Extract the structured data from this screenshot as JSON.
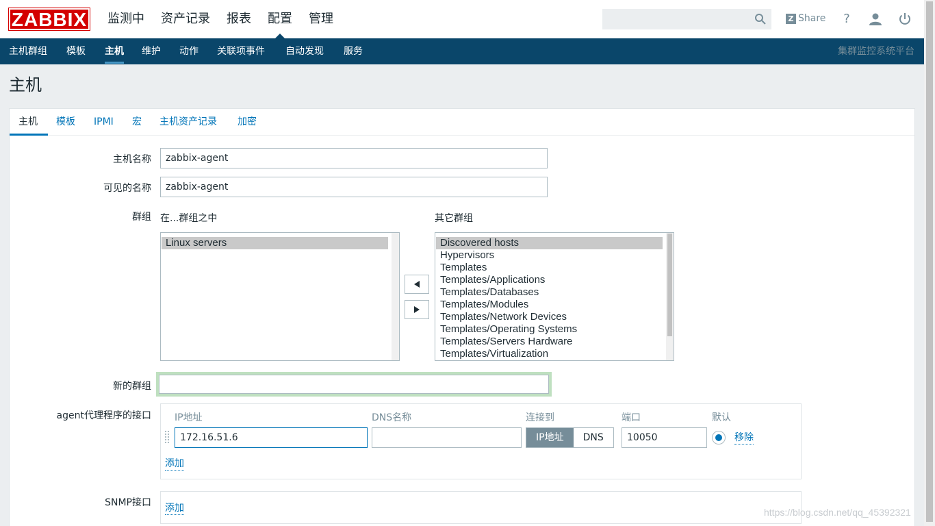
{
  "header": {
    "logo": "ZABBIX",
    "menu": [
      "监测中",
      "资产记录",
      "报表",
      "配置",
      "管理"
    ],
    "search_placeholder": "",
    "share_label": "Share",
    "icons": [
      "search-icon",
      "help-icon",
      "user-icon",
      "power-icon"
    ]
  },
  "subnav": {
    "items": [
      "主机群组",
      "模板",
      "主机",
      "维护",
      "动作",
      "关联项事件",
      "自动发现",
      "服务"
    ],
    "brand": "集群监控系统平台"
  },
  "page": {
    "title": "主机"
  },
  "tabs": [
    "主机",
    "模板",
    "IPMI",
    "宏",
    "主机资产记录",
    "加密"
  ],
  "form": {
    "host_name_label": "主机名称",
    "host_name_value": "zabbix-agent",
    "visible_name_label": "可见的名称",
    "visible_name_value": "zabbix-agent",
    "groups_label": "群组",
    "in_groups_label": "在...群组之中",
    "other_groups_label": "其它群组",
    "in_groups": [
      "Linux servers"
    ],
    "other_groups": [
      "Discovered hosts",
      "Hypervisors",
      "Templates",
      "Templates/Applications",
      "Templates/Databases",
      "Templates/Modules",
      "Templates/Network Devices",
      "Templates/Operating Systems",
      "Templates/Servers Hardware",
      "Templates/Virtualization"
    ],
    "new_group_label": "新的群组",
    "new_group_value": "",
    "agent_interfaces_label": "agent代理程序的接口",
    "col_ip": "IP地址",
    "col_dns": "DNS名称",
    "col_connect": "连接到",
    "col_port": "端口",
    "col_default": "默认",
    "ip_value": "172.16.51.6",
    "dns_value": "",
    "connect_ip": "IP地址",
    "connect_dns": "DNS",
    "port_value": "10050",
    "remove_label": "移除",
    "add_label": "添加",
    "snmp_label": "SNMP接口",
    "snmp_add_label": "添加"
  },
  "watermark": "https://blog.csdn.net/qq_45392321",
  "colors": {
    "brand_red": "#d40000",
    "nav_blue": "#0a466a",
    "link_blue": "#0275b8"
  }
}
